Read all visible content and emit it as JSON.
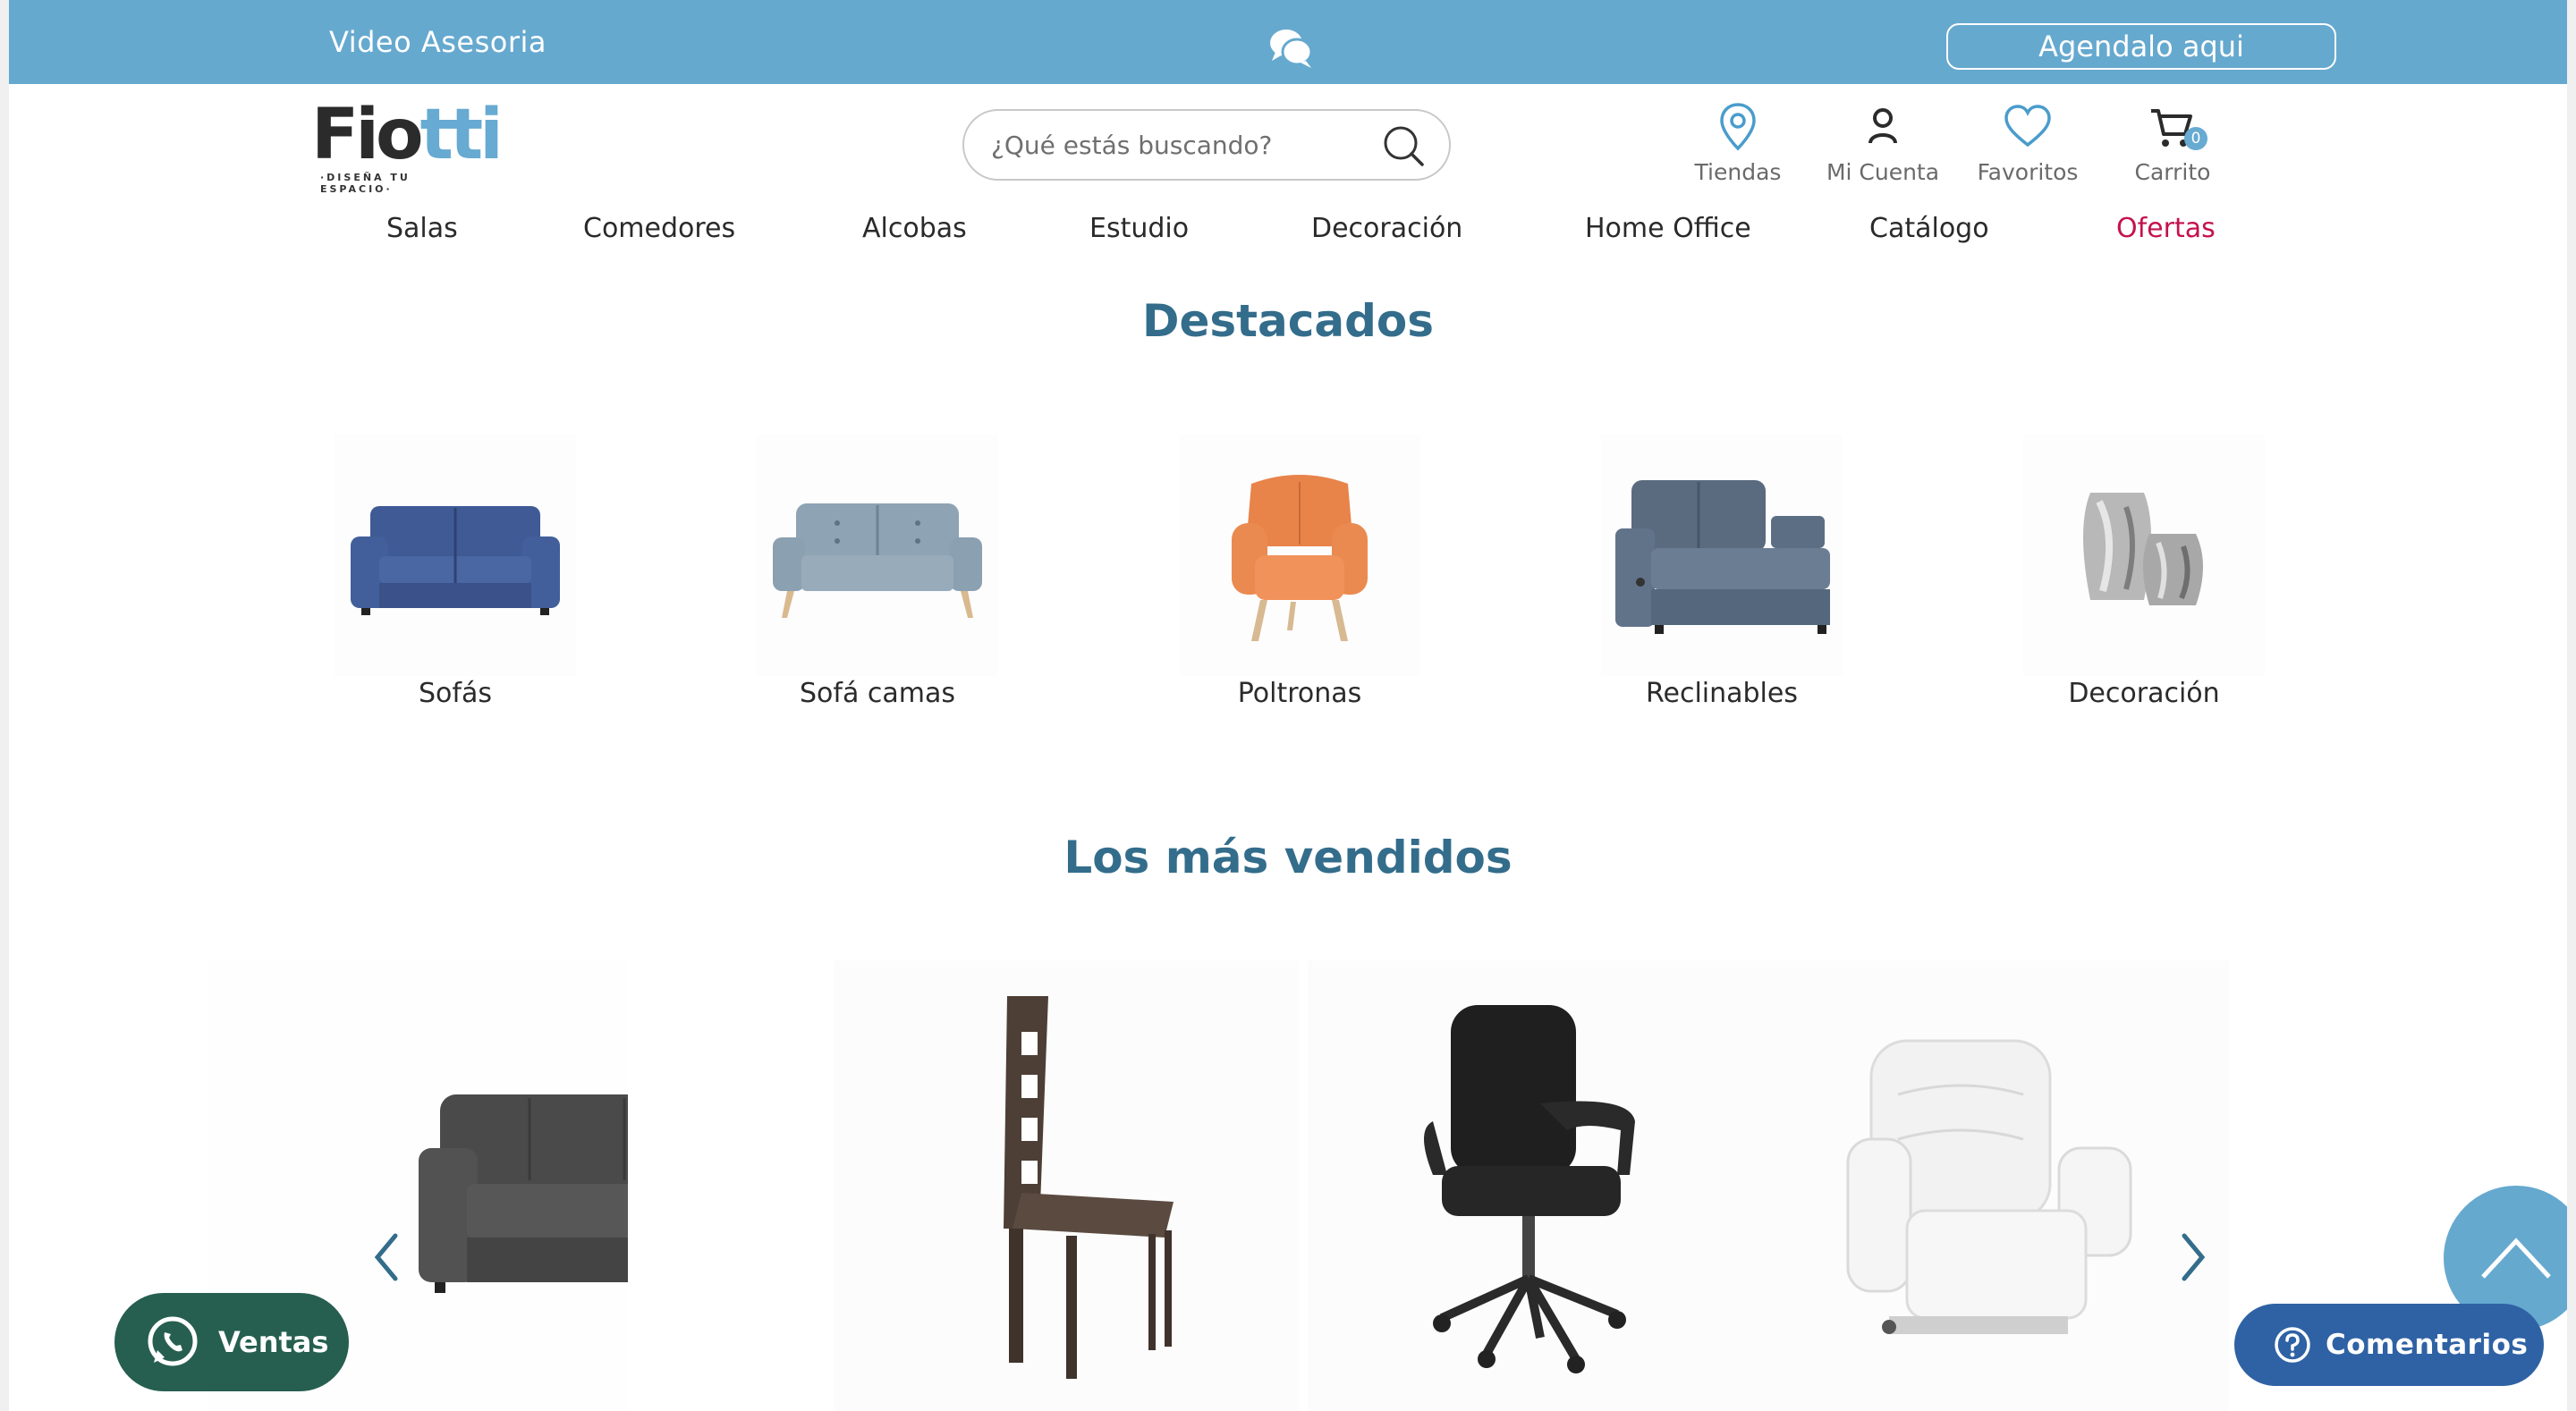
{
  "topbar": {
    "video_label": "Video Asesoria",
    "cta_label": "Agendalo aqui"
  },
  "logo": {
    "word_a": "Fio",
    "word_b": "tti",
    "tagline": "·DISEÑA TU ESPACIO·"
  },
  "search": {
    "placeholder": "¿Qué estás buscando?"
  },
  "header_icons": {
    "stores": "Tiendas",
    "account": "Mi Cuenta",
    "favorites": "Favoritos",
    "cart": "Carrito",
    "cart_count": "0"
  },
  "nav": [
    {
      "label": "Salas"
    },
    {
      "label": "Comedores"
    },
    {
      "label": "Alcobas"
    },
    {
      "label": "Estudio"
    },
    {
      "label": "Decoración"
    },
    {
      "label": "Home Office"
    },
    {
      "label": "Catálogo"
    },
    {
      "label": "Ofertas"
    }
  ],
  "featured": {
    "title": "Destacados",
    "items": [
      {
        "label": "Sofás",
        "icon": "blue-sofa"
      },
      {
        "label": "Sofá camas",
        "icon": "grey-sofa-bed"
      },
      {
        "label": "Poltronas",
        "icon": "orange-armchair"
      },
      {
        "label": "Reclinables",
        "icon": "recliner-loveseat"
      },
      {
        "label": "Decoración",
        "icon": "silver-vases"
      }
    ]
  },
  "bestsellers": {
    "title": "Los más vendidos",
    "items": [
      {
        "icon": "dark-recliner-sofa"
      },
      {
        "icon": "brown-dining-chair"
      },
      {
        "icon": "black-office-chair"
      },
      {
        "icon": "white-lift-recliner"
      }
    ]
  },
  "floating": {
    "ventas_label": "Ventas",
    "comentarios_label": "Comentarios"
  },
  "colors": {
    "brand_blue": "#66a9cf",
    "title_blue": "#336d8b",
    "offer_red": "#c4124f",
    "whatsapp_green": "#265f50",
    "comment_blue": "#2f62a4"
  }
}
